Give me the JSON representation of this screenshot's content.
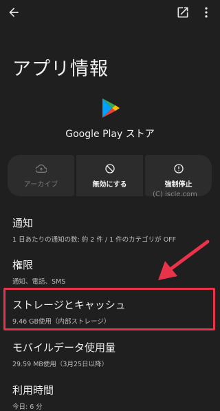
{
  "page_title": "アプリ情報",
  "app": {
    "name": "Google Play ストア"
  },
  "actions": [
    {
      "label": "アーカイブ",
      "icon": "cloud-upload-icon",
      "enabled": false
    },
    {
      "label": "無効にする",
      "icon": "disable-icon",
      "enabled": true
    },
    {
      "label": "強制停止",
      "icon": "info-alert-icon",
      "enabled": true
    }
  ],
  "watermark": "(C) iscle.com",
  "rows": {
    "notifications": {
      "title": "通知",
      "subtitle": "1 日あたりの通知の数: 約 2 件 / 1 件のカテゴリが OFF"
    },
    "permissions": {
      "title": "権限",
      "subtitle": "通知、電話、SMS"
    },
    "storage": {
      "title": "ストレージとキャッシュ",
      "subtitle": "9.46 GB使用（内部ストレージ）"
    },
    "mobile_data": {
      "title": "モバイルデータ使用量",
      "subtitle": "29.59 MB使用（3月25日以降）"
    },
    "usage_time": {
      "title": "利用時間",
      "subtitle": "今日: 6 分"
    }
  },
  "colors": {
    "background": "#1f1f1f",
    "highlight": "#e8334a",
    "button_bg": "#2c2c2c"
  }
}
